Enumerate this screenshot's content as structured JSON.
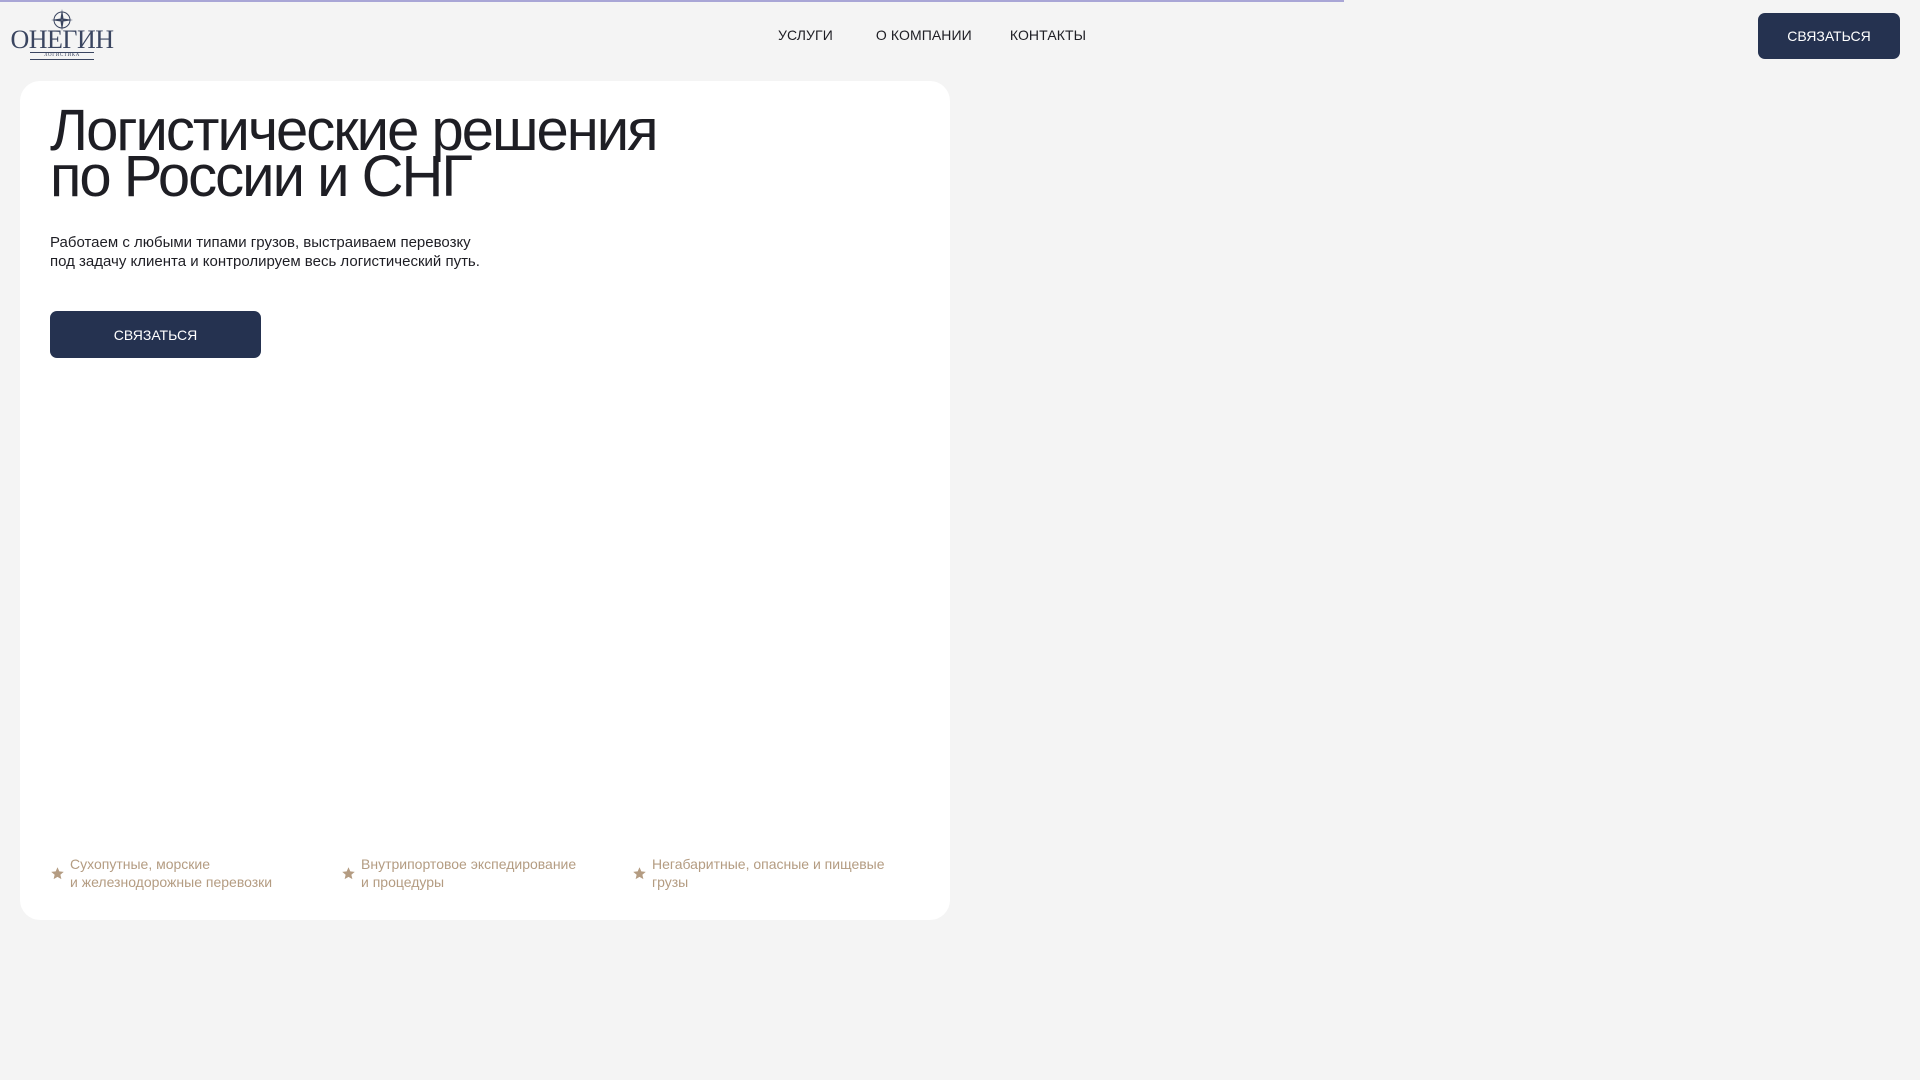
{
  "header": {
    "logo": {
      "wordmark": "ОНЕГИН",
      "tagline": "ЛОГИСТИКА"
    },
    "nav": [
      {
        "label": "УСЛУГИ"
      },
      {
        "label": "О КОМПАНИИ"
      },
      {
        "label": "КОНТАКТЫ"
      }
    ],
    "cta_label": "СВЯЗАТЬСЯ"
  },
  "hero": {
    "title_lines": [
      "Логистические решения",
      "по России и СНГ"
    ],
    "description_lines": [
      "Работаем с любыми типами грузов, выстраиваем перевозку",
      "под задачу клиента и контролируем весь логистический путь."
    ],
    "cta_label": "СВЯЗАТЬСЯ",
    "features": [
      {
        "icon": "star-icon",
        "lines": [
          "Сухопутные, морские",
          "и железнодорожные перевозки"
        ]
      },
      {
        "icon": "star-icon",
        "lines": [
          "Внутрипортовое экспедирование",
          "и процедуры"
        ]
      },
      {
        "icon": "star-icon",
        "lines": [
          "Негабаритные, опасные и пищевые",
          "грузы"
        ]
      }
    ]
  },
  "colors": {
    "background": "#f4f4f4",
    "card": "#ffffff",
    "button": "#253250",
    "accent": "#b49c82",
    "progress": "#a9a6d6"
  }
}
